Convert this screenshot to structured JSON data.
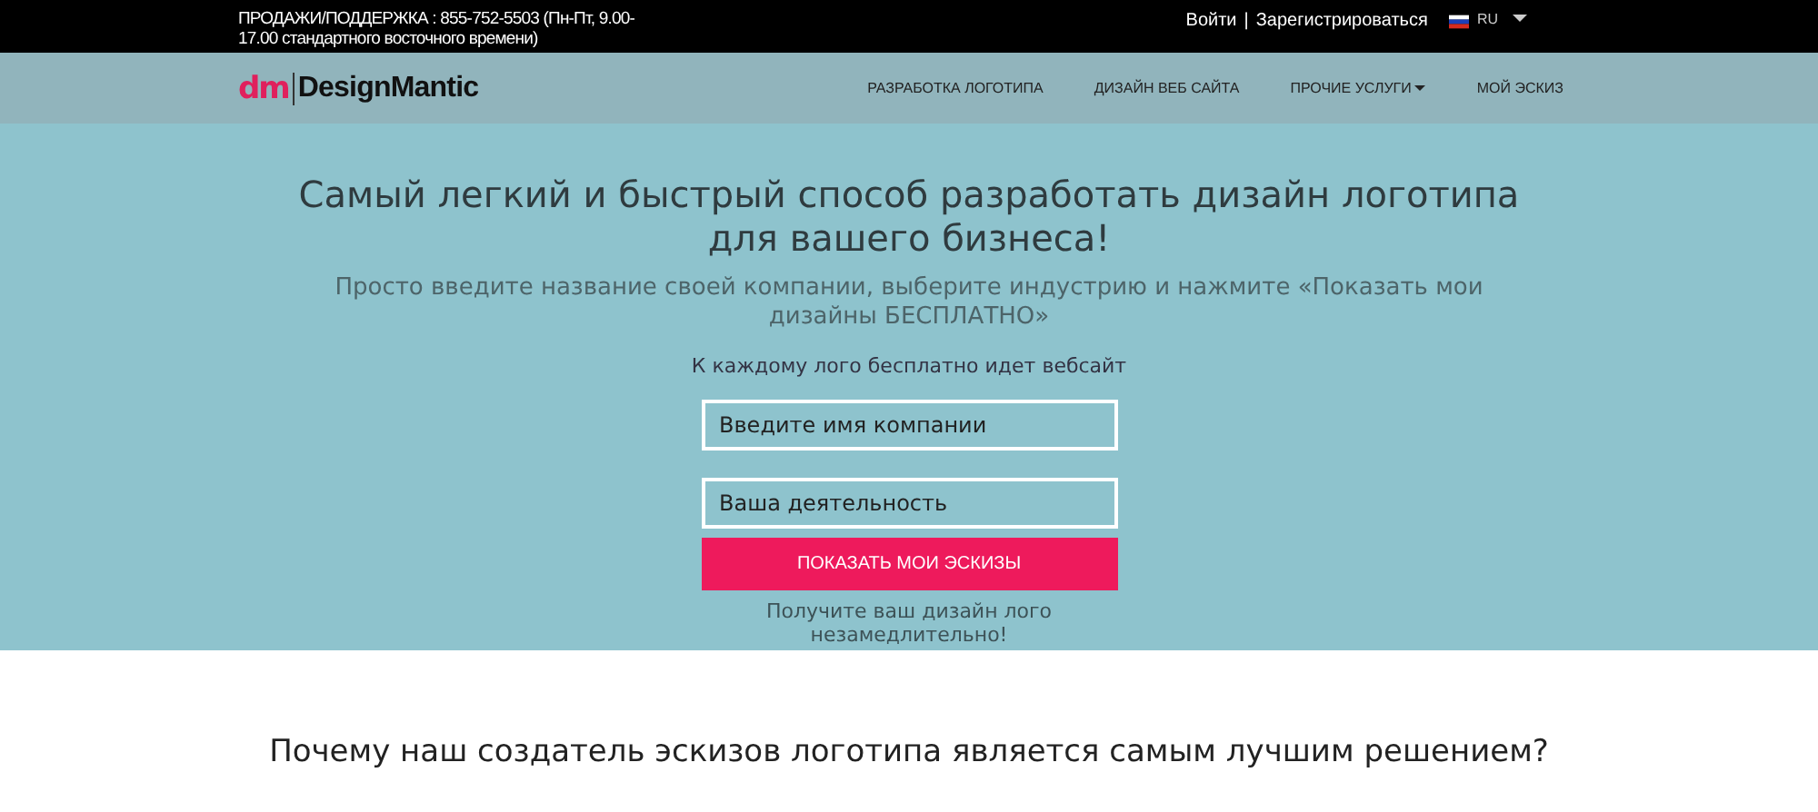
{
  "top_bar": {
    "support_text": "ПРОДАЖИ/ПОДДЕРЖКА : 855-752-5503 (Пн-Пт, 9.00-17.00 стандартного восточного времени)",
    "login": "Войти",
    "separator": "|",
    "register": "Зарегистрироваться",
    "language": "RU"
  },
  "navbar": {
    "logo_mark": "dm",
    "logo_text": "DesignMantic",
    "items": [
      {
        "label": "РАЗРАБОТКА ЛОГОТИПА",
        "dropdown": false
      },
      {
        "label": "ДИЗАЙН ВЕБ САЙТА",
        "dropdown": false
      },
      {
        "label": "ПРОЧИЕ УСЛУГИ",
        "dropdown": true
      },
      {
        "label": "МОЙ ЭСКИЗ",
        "dropdown": false
      }
    ]
  },
  "hero": {
    "title": "Самый легкий и быстрый способ разработать дизайн логотипа для вашего бизнеса!",
    "subtitle": "Просто введите название своей компании, выберите индустрию и нажмите «Показать мои дизайны БЕСПЛАТНО»",
    "note": "К каждому лого бесплатно идет вебсайт",
    "fields": [
      {
        "placeholder": "Введите имя компании"
      },
      {
        "placeholder": "Ваша деятельность"
      }
    ],
    "button": "ПОКАЗАТЬ МОИ ЭСКИЗЫ",
    "caption": "Получите ваш дизайн лого незамедлительно!"
  },
  "section": {
    "heading": "Почему наш создатель эскизов логотипа является самым лучшим решением?"
  }
}
